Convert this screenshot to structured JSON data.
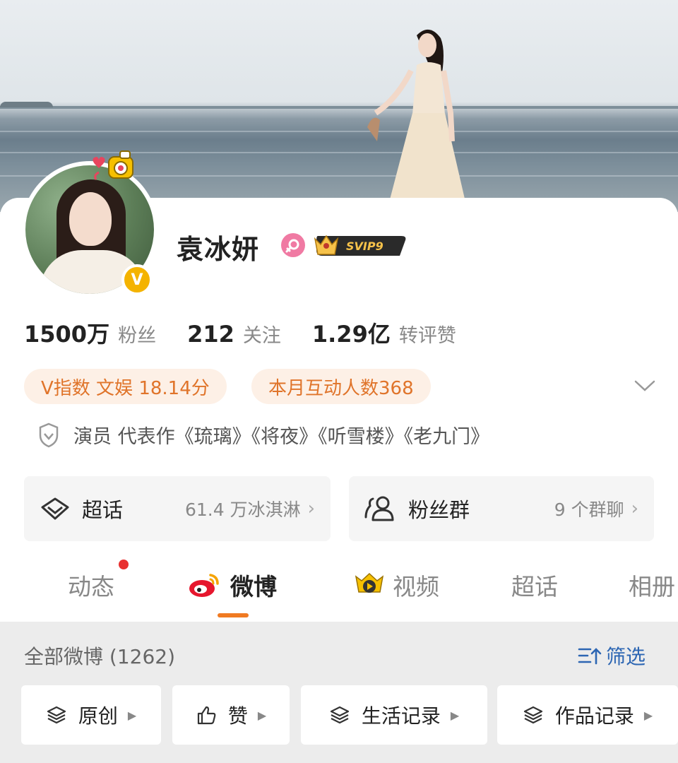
{
  "profile": {
    "name": "袁冰妍",
    "svip_label": "SVIP9",
    "verified_mark": "V"
  },
  "stats": [
    {
      "value": "1500万",
      "label": "粉丝"
    },
    {
      "value": "212",
      "label": "关注"
    },
    {
      "value": "1.29亿",
      "label": "转评赞"
    }
  ],
  "badges": {
    "v_index": "V指数 文娱 18.14分",
    "interaction": "本月互动人数368"
  },
  "intro": "演员 代表作《琉璃》《将夜》《听雪楼》《老九门》",
  "boxes": {
    "supertopic": {
      "title": "超话",
      "sub": "61.4 万冰淇淋"
    },
    "fan_group": {
      "title": "粉丝群",
      "sub": "9 个群聊"
    }
  },
  "tabs": [
    {
      "label": "动态"
    },
    {
      "label": "微博"
    },
    {
      "label": "视频"
    },
    {
      "label": "超话"
    },
    {
      "label": "相册"
    }
  ],
  "feed": {
    "title": "全部微博 (1262)",
    "filter_label": "筛选"
  },
  "chips": [
    {
      "label": "原创"
    },
    {
      "label": "赞"
    },
    {
      "label": "生活记录"
    },
    {
      "label": "作品记录"
    }
  ],
  "colors": {
    "accent_orange": "#f07a22",
    "pill_text": "#e0742a",
    "pill_bg": "#fdf0e6",
    "link_blue": "#2d66b3",
    "vip_gold": "#f4b300",
    "notification_red": "#e8302f"
  }
}
